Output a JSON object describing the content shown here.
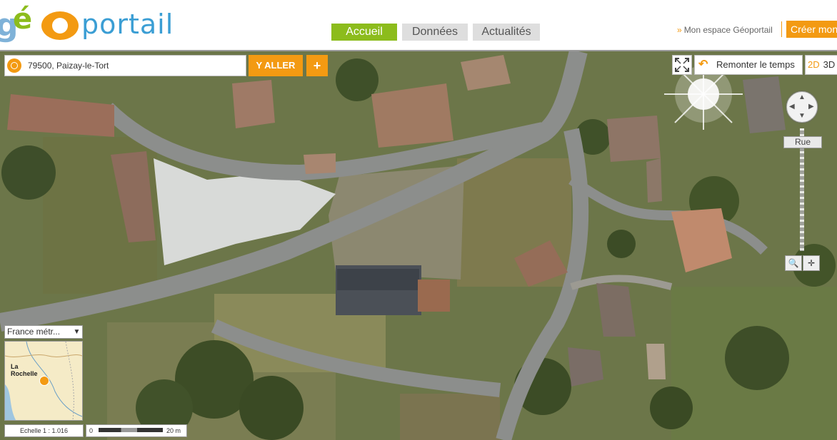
{
  "logo": {
    "g": "g",
    "e": "é",
    "portail": "portail"
  },
  "nav_tabs": {
    "accueil": "Accueil",
    "donnees": "Données",
    "actualites": "Actualités"
  },
  "header": {
    "mon_espace": "Mon espace Géoportail",
    "mon_espace_arrow": "»",
    "creer": "Créer mon"
  },
  "search": {
    "value": "79500, Paizay-le-Tort",
    "go": "Y ALLER",
    "plus": "+"
  },
  "controls": {
    "time": "Remonter le temps",
    "undo": "↶",
    "mode_2d": "2D",
    "mode_3d": "3D",
    "rue": "Rue",
    "zoom_box": "🔍",
    "zoom_center": "✛",
    "pan_up": "▲",
    "pan_down": "▼",
    "pan_left": "◀",
    "pan_right": "▶"
  },
  "overview": {
    "territory": "France métr...",
    "territory_arrow": "▼",
    "city_line1": "La",
    "city_line2": "Rochelle"
  },
  "scale": {
    "ratio": "Echelle 1 :  1.016",
    "zero": "0",
    "length": "20 m"
  },
  "colors": {
    "accent": "#f39a12",
    "active_tab": "#8cbc1c",
    "brand_blue": "#3b9ed4"
  },
  "icons": {
    "locate": "locate-icon",
    "fullscreen": "fullscreen-icon",
    "undo": "undo-icon",
    "pan": "pan-control-icon"
  }
}
